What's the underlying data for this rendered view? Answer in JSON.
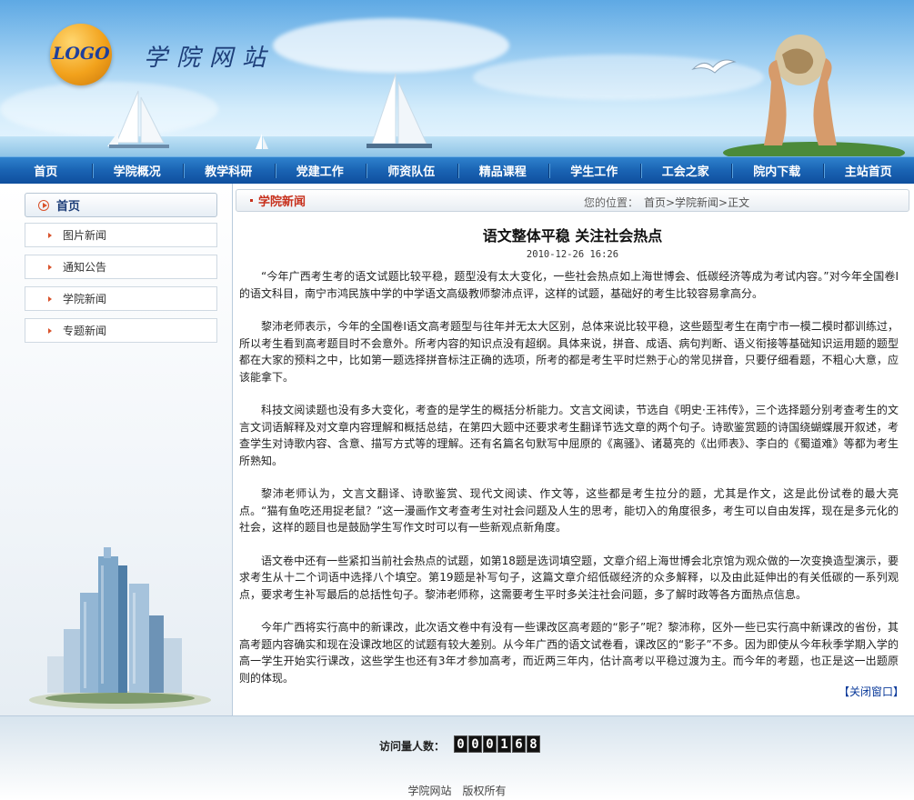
{
  "header": {
    "logo_text": "LOGO",
    "site_name": "学院网站"
  },
  "nav": {
    "items": [
      "首页",
      "学院概况",
      "教学科研",
      "党建工作",
      "师资队伍",
      "精品课程",
      "学生工作",
      "工会之家",
      "院内下载",
      "主站首页"
    ]
  },
  "sidebar": {
    "home_label": "首页",
    "items": [
      "图片新闻",
      "通知公告",
      "学院新闻",
      "专题新闻"
    ]
  },
  "crumb": {
    "section_title": "学院新闻",
    "location_label": "您的位置：",
    "path": "首页>学院新闻>正文"
  },
  "article": {
    "title": "语文整体平稳 关注社会热点",
    "date": "2010-12-26 16:26",
    "paragraphs": [
      "“今年广西考生考的语文试题比较平稳，题型没有太大变化，一些社会热点如上海世博会、低碳经济等成为考试内容。”对今年全国卷Ⅰ的语文科目，南宁市鸿民族中学的中学语文高级教师黎沛点评，这样的试题，基础好的考生比较容易拿高分。",
      "黎沛老师表示，今年的全国卷Ⅰ语文高考题型与往年并无太大区别，总体来说比较平稳，这些题型考生在南宁市一模二模时都训练过，所以考生看到高考题目时不会意外。所考内容的知识点没有超纲。具体来说，拼音、成语、病句判断、语义衔接等基础知识运用题的题型都在大家的预料之中，比如第一题选择拼音标注正确的选项，所考的都是考生平时烂熟于心的常见拼音，只要仔细看题，不粗心大意，应该能拿下。",
      "科技文阅读题也没有多大变化，考查的是学生的概括分析能力。文言文阅读，节选自《明史·王祎传》，三个选择题分别考查考生的文言文词语解释及对文章内容理解和概括总结，在第四大题中还要求考生翻译节选文章的两个句子。诗歌鉴赏题的诗国绕蝴蝶展开叙述，考查学生对诗歌内容、含意、描写方式等的理解。还有名篇名句默写中屈原的《离骚》、诸葛亮的《出师表》、李白的《蜀道难》等都为考生所熟知。",
      "黎沛老师认为，文言文翻译、诗歌鉴赏、现代文阅读、作文等，这些都是考生拉分的题，尤其是作文，这是此份试卷的最大亮点。“猫有鱼吃还用捉老鼠？”这一漫画作文考查考生对社会问题及人生的思考，能切入的角度很多，考生可以自由发挥，现在是多元化的社会，这样的题目也是鼓励学生写作文时可以有一些新观点新角度。",
      "语文卷中还有一些紧扣当前社会热点的试题，如第18题是选词填空题，文章介绍上海世博会北京馆为观众做的一次变换造型演示，要求考生从十二个词语中选择八个填空。第19题是补写句子，这篇文章介绍低碳经济的众多解释，以及由此延伸出的有关低碳的一系列观点，要求考生补写最后的总括性句子。黎沛老师称，这需要考生平时多关注社会问题，多了解时政等各方面热点信息。",
      "今年广西将实行高中的新课改，此次语文卷中有没有一些课改区高考题的“影子”呢？黎沛称，区外一些已实行高中新课改的省份，其高考题内容确实和现在没课改地区的试题有较大差别。从今年广西的语文试卷看，课改区的“影子”不多。因为即使从今年秋季学期入学的高一学生开始实行课改，这些学生也还有3年才参加高考，而近两三年内，估计高考以平稳过渡为主。而今年的考题，也正是这一出题原则的体现。"
    ],
    "close_link": "【关闭窗口】"
  },
  "footer": {
    "visit_label": "访问量人数：",
    "counter": [
      "0",
      "0",
      "0",
      "1",
      "6",
      "8"
    ],
    "copyright": "学院网站　版权所有"
  }
}
